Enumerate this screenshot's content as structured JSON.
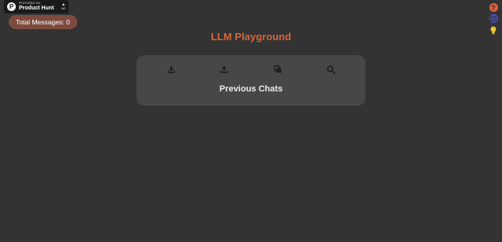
{
  "product_hunt": {
    "featured_text": "FEATURED ON",
    "name": "Product Hunt",
    "vote_count": "60",
    "logo_letter": "P"
  },
  "stats": {
    "total_messages_label": "Total Messages: 0"
  },
  "header": {
    "title": "LLM Playground"
  },
  "side_icons": [
    "help-icon",
    "robot-icon",
    "lightbulb-icon"
  ],
  "chats": {
    "title": "Previous Chats",
    "tools": [
      "download-icon",
      "upload-icon",
      "copy-icon",
      "search-icon"
    ]
  },
  "colors": {
    "background": "#333333",
    "accent": "#d4653a",
    "panel": "#474747",
    "pill": "#7d4a3e",
    "robot": "#4a4fd0",
    "bulb": "#f2c12e"
  }
}
